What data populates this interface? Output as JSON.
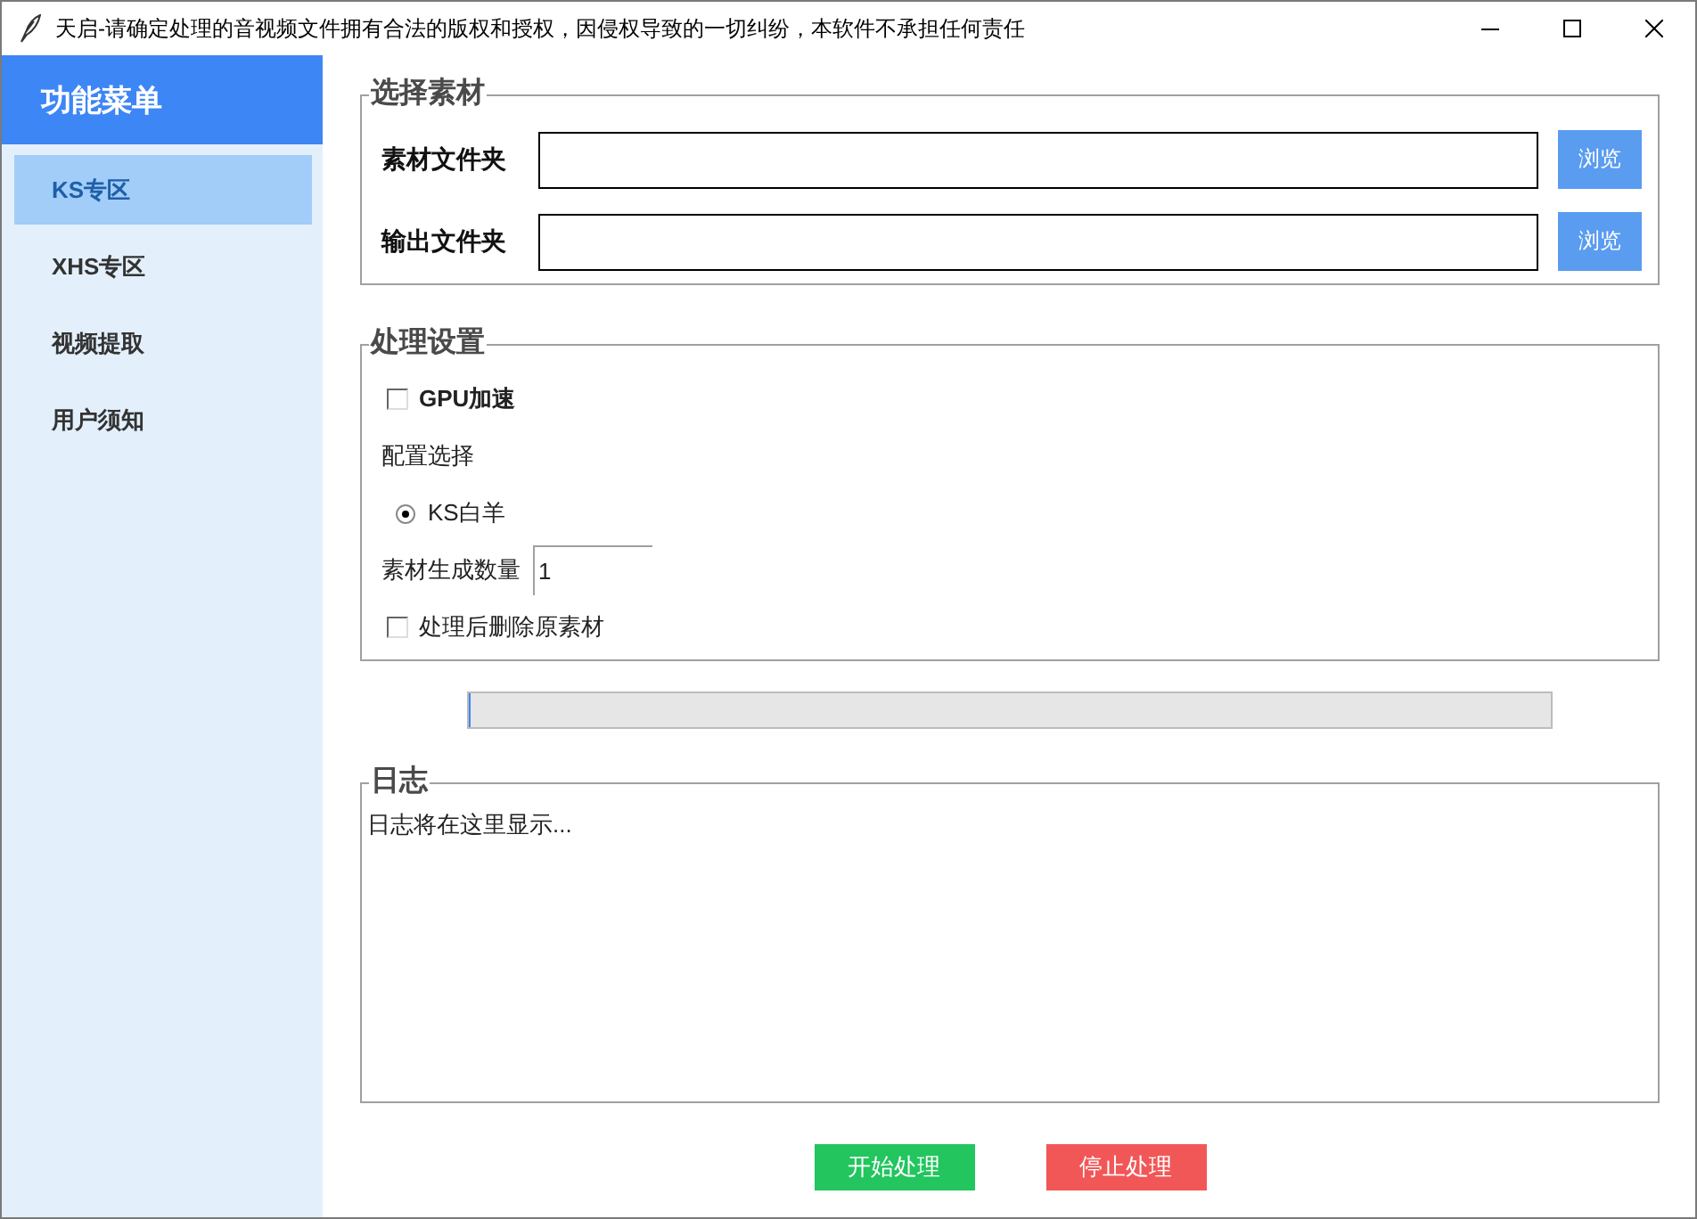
{
  "window": {
    "title": "天启-请确定处理的音视频文件拥有合法的版权和授权，因侵权导致的一切纠纷，本软件不承担任何责任"
  },
  "sidebar": {
    "header": "功能菜单",
    "items": [
      {
        "label": "KS专区",
        "selected": true
      },
      {
        "label": "XHS专区",
        "selected": false
      },
      {
        "label": "视频提取",
        "selected": false
      },
      {
        "label": "用户须知",
        "selected": false
      }
    ]
  },
  "material": {
    "title": "选择素材",
    "rows": [
      {
        "label": "素材文件夹",
        "button": "浏览"
      },
      {
        "label": "输出文件夹",
        "button": "浏览"
      }
    ]
  },
  "settings": {
    "title": "处理设置",
    "gpu": {
      "label": "GPU加速",
      "checked": false
    },
    "config": {
      "label": "配置选择",
      "options": [
        {
          "label": "KS白羊",
          "selected": true
        }
      ]
    },
    "count": {
      "label": "素材生成数量",
      "value": "1"
    },
    "delete_source": {
      "label": "处理后删除原素材",
      "checked": false
    }
  },
  "progress": {
    "level": 0
  },
  "log": {
    "title": "日志",
    "text": "日志将在这里显示..."
  },
  "actions": [
    {
      "kind": "start",
      "label": "开始处理"
    },
    {
      "kind": "stop",
      "label": "停止处理"
    }
  ]
}
